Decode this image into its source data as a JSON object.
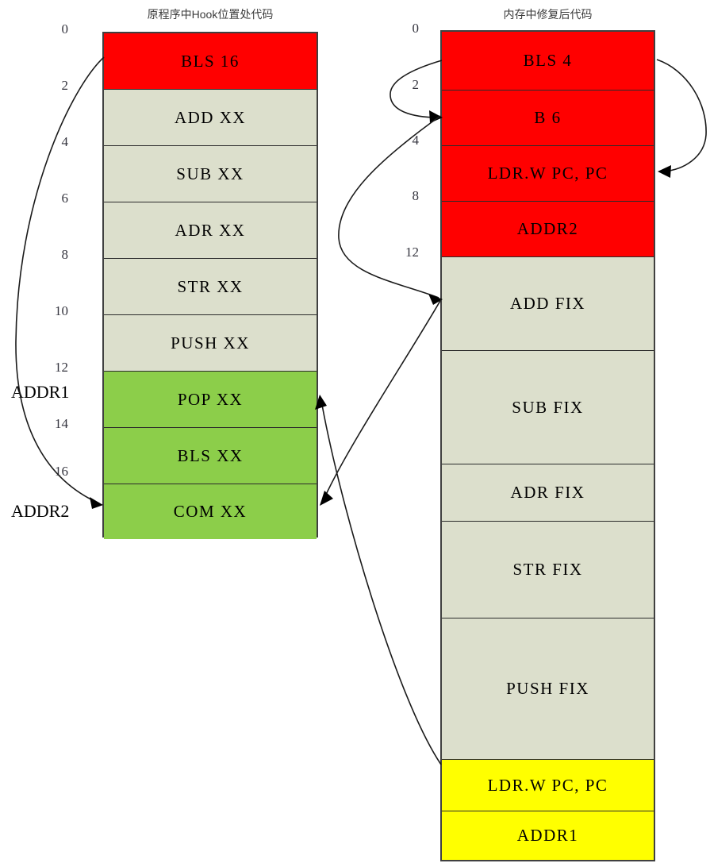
{
  "colors": {
    "red": "#ff0000",
    "green": "#8cce4a",
    "beige": "#dcdfcc",
    "yellow": "#ffff00",
    "border": "#404040",
    "title_text": "#3b3b3b",
    "offset_text": "#35353f"
  },
  "left_column": {
    "title": "原程序中Hook位置处代码",
    "offsets": [
      "0",
      "2",
      "4",
      "6",
      "8",
      "10",
      "12",
      "14",
      "16"
    ],
    "rows": [
      {
        "label": "BLS 16",
        "fill": "red"
      },
      {
        "label": "ADD XX",
        "fill": "beige"
      },
      {
        "label": "SUB XX",
        "fill": "beige"
      },
      {
        "label": "ADR XX",
        "fill": "beige"
      },
      {
        "label": "STR XX",
        "fill": "beige"
      },
      {
        "label": "PUSH XX",
        "fill": "beige"
      },
      {
        "label": "POP XX",
        "fill": "green"
      },
      {
        "label": "BLS XX",
        "fill": "green"
      },
      {
        "label": "COM XX",
        "fill": "green"
      }
    ],
    "addr_labels": [
      {
        "text": "ADDR1"
      },
      {
        "text": "ADDR2"
      }
    ]
  },
  "right_column": {
    "title": "内存中修复后代码",
    "offsets": [
      "0",
      "2",
      "4",
      "8",
      "12"
    ],
    "rows": [
      {
        "label": "BLS 4",
        "fill": "red"
      },
      {
        "label": "B 6",
        "fill": "red"
      },
      {
        "label": "LDR.W PC, PC",
        "fill": "red"
      },
      {
        "label": "ADDR2",
        "fill": "red"
      },
      {
        "label": "ADD FIX",
        "fill": "beige"
      },
      {
        "label": "SUB FIX",
        "fill": "beige"
      },
      {
        "label": "ADR FIX",
        "fill": "beige"
      },
      {
        "label": "STR FIX",
        "fill": "beige"
      },
      {
        "label": "PUSH FIX",
        "fill": "beige"
      },
      {
        "label": "LDR.W PC, PC",
        "fill": "yellow"
      },
      {
        "label": "ADDR1",
        "fill": "yellow"
      }
    ]
  }
}
